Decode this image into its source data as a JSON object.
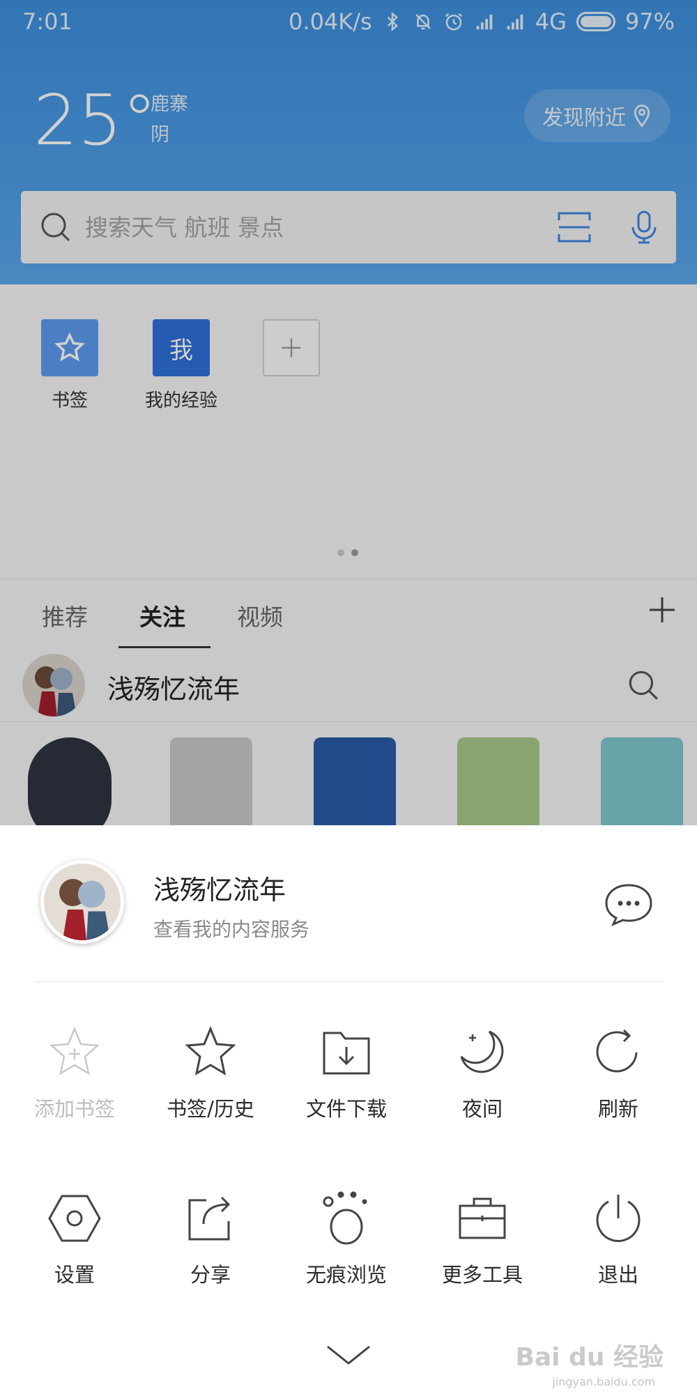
{
  "status_bar": {
    "time": "7:01",
    "net_speed": "0.04K/s",
    "network": "4G",
    "battery": "97%"
  },
  "weather": {
    "temperature": "25°",
    "location": "鹿寨",
    "condition": "阴"
  },
  "nearby_button": "发现附近",
  "search": {
    "placeholder": "搜索天气 航班 景点"
  },
  "shortcuts": [
    {
      "label": "书签"
    },
    {
      "label": "我的经验",
      "tile_text": "我"
    },
    {
      "label": ""
    }
  ],
  "feed_tabs": [
    {
      "label": "推荐"
    },
    {
      "label": "关注"
    },
    {
      "label": "视频"
    }
  ],
  "follow_row": {
    "name": "浅殇忆流年"
  },
  "profile": {
    "name": "浅殇忆流年",
    "subtitle": "查看我的内容服务"
  },
  "menu": {
    "row1": [
      {
        "label": "添加书签",
        "icon": "add-bookmark-icon",
        "disabled": true
      },
      {
        "label": "书签/历史",
        "icon": "star-icon"
      },
      {
        "label": "文件下载",
        "icon": "download-folder-icon"
      },
      {
        "label": "夜间",
        "icon": "moon-icon"
      },
      {
        "label": "刷新",
        "icon": "refresh-icon"
      }
    ],
    "row2": [
      {
        "label": "设置",
        "icon": "settings-hexagon-icon"
      },
      {
        "label": "分享",
        "icon": "share-icon"
      },
      {
        "label": "无痕浏览",
        "icon": "paw-icon"
      },
      {
        "label": "更多工具",
        "icon": "toolbox-icon"
      },
      {
        "label": "退出",
        "icon": "power-icon"
      }
    ]
  },
  "watermark": {
    "text": "Bai du 经验",
    "url": "jingyan.baidu.com"
  },
  "colors": {
    "header_blue": "#4d9ce6",
    "accent_blue": "#2e6fd7",
    "icon_gray": "#555555"
  }
}
